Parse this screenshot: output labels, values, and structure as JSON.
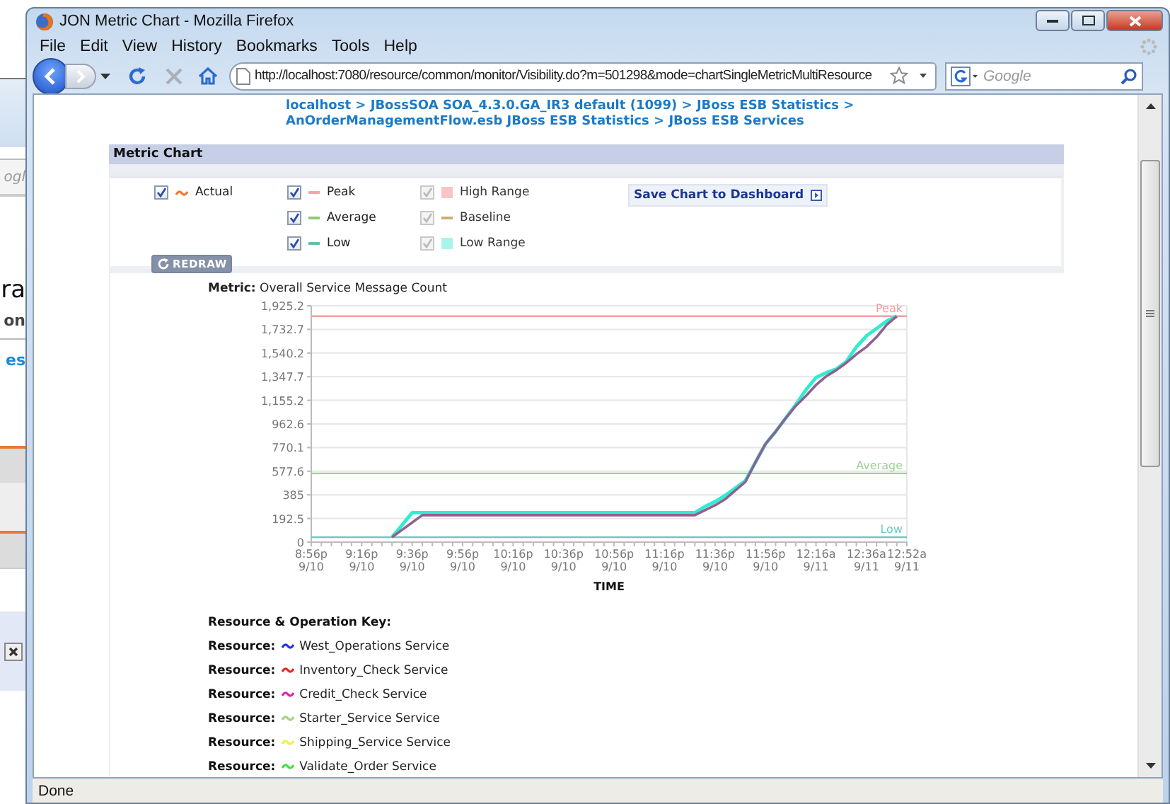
{
  "background_window": {
    "texts": [
      {
        "kind": "field",
        "text": "ogl"
      },
      {
        "kind": "heading",
        "text": "ra"
      },
      {
        "kind": "subheading",
        "text": "on"
      },
      {
        "kind": "link",
        "text": "es"
      }
    ]
  },
  "window": {
    "title": "JON Metric Chart - Mozilla Firefox"
  },
  "menu": [
    "File",
    "Edit",
    "View",
    "History",
    "Bookmarks",
    "Tools",
    "Help"
  ],
  "address_bar": {
    "value": "http://localhost:7080/resource/common/monitor/Visibility.do?m=501298&mode=chartSingleMetricMultiResource"
  },
  "search": {
    "placeholder": "Google"
  },
  "breadcrumb": [
    {
      "kind": "link",
      "text": "localhost"
    },
    {
      "kind": "separator",
      "text": ">"
    },
    {
      "kind": "link",
      "text": "JBossSOA SOA_4.3.0.GA_IR3 default (1099)"
    },
    {
      "kind": "separator",
      "text": ">"
    },
    {
      "kind": "link",
      "text": "JBoss ESB Statistics"
    },
    {
      "kind": "separator",
      "text": ">"
    },
    {
      "kind": "link",
      "text": "AnOrderManagementFlow.esb JBoss ESB Statistics"
    },
    {
      "kind": "separator",
      "text": ">"
    },
    {
      "kind": "link",
      "text": "JBoss ESB Services"
    }
  ],
  "panel": {
    "title": "Metric Chart",
    "options": {
      "columns": [
        [
          {
            "label": "Actual",
            "kind": "wave",
            "color": "#f07830",
            "checked": true,
            "disabled": false
          }
        ],
        [
          {
            "label": "Peak",
            "kind": "line",
            "color": "#f0a8a8",
            "checked": true,
            "disabled": false
          },
          {
            "label": "Average",
            "kind": "line",
            "color": "#90c878",
            "checked": true,
            "disabled": false
          },
          {
            "label": "Low",
            "kind": "line",
            "color": "#60c0b0",
            "checked": true,
            "disabled": false
          }
        ],
        [
          {
            "label": "High Range",
            "kind": "square",
            "color": "#f8c4c4",
            "checked": true,
            "disabled": true
          },
          {
            "label": "Baseline",
            "kind": "line",
            "color": "#c8b070",
            "checked": true,
            "disabled": true
          },
          {
            "label": "Low Range",
            "kind": "square",
            "color": "#a8f4ec",
            "checked": true,
            "disabled": true
          }
        ]
      ]
    },
    "redraw_button": "REDRAW",
    "save_button": "Save Chart to Dashboard",
    "chart_data": {
      "type": "line",
      "title": "**Metric:** Overall Service Message Count",
      "xlabel": "TIME",
      "categories": [
        "8:56p 9/10",
        null,
        null,
        null,
        null,
        "9:16p 9/10",
        null,
        null,
        null,
        null,
        "9:36p 9/10",
        null,
        null,
        null,
        null,
        "9:56p 9/10",
        null,
        null,
        null,
        null,
        "10:16p 9/10",
        null,
        null,
        null,
        null,
        "10:36p 9/10",
        null,
        null,
        null,
        null,
        "10:56p 9/10",
        null,
        null,
        null,
        null,
        "11:16p 9/10",
        null,
        null,
        null,
        null,
        "11:36p 9/10",
        null,
        null,
        null,
        null,
        "11:56p 9/10",
        null,
        null,
        null,
        null,
        "12:16a 9/11",
        null,
        null,
        null,
        null,
        "12:36a 9/11",
        null,
        null,
        null,
        "12:52a 9/11"
      ],
      "series": [
        {
          "color": "#30ecd0",
          "values": [
            null,
            null,
            null,
            null,
            null,
            null,
            null,
            null,
            40,
            140,
            240,
            240,
            240,
            240,
            240,
            240,
            240,
            240,
            240,
            240,
            240,
            240,
            240,
            240,
            240,
            240,
            240,
            240,
            240,
            240,
            240,
            240,
            240,
            240,
            240,
            240,
            240,
            240,
            240,
            290,
            330,
            380,
            440,
            500,
            650,
            800,
            900,
            1010,
            1120,
            1240,
            1340,
            1380,
            1410,
            1470,
            1590,
            1680,
            1740,
            1800,
            1840,
            null
          ]
        },
        {
          "color": "#906090",
          "values": [
            null,
            null,
            null,
            null,
            null,
            null,
            null,
            null,
            40,
            100,
            160,
            220,
            220,
            220,
            220,
            220,
            220,
            220,
            220,
            220,
            220,
            220,
            220,
            220,
            220,
            220,
            220,
            220,
            220,
            220,
            220,
            220,
            220,
            220,
            220,
            220,
            220,
            220,
            220,
            260,
            300,
            350,
            420,
            490,
            650,
            800,
            900,
            1010,
            1110,
            1190,
            1280,
            1350,
            1400,
            1460,
            1530,
            1590,
            1670,
            1770,
            1840,
            null
          ]
        }
      ],
      "ylim": [
        0,
        1925.2
      ],
      "yticks": [
        {
          "value": 0,
          "label": "0"
        },
        {
          "value": 192.5,
          "label": "192.5"
        },
        {
          "value": 385,
          "label": "385"
        },
        {
          "value": 577.6,
          "label": "577.6"
        },
        {
          "value": 770.1,
          "label": "770.1"
        },
        {
          "value": 962.6,
          "label": "962.6"
        },
        {
          "value": 1155.2,
          "label": "1,155.2"
        },
        {
          "value": 1347.7,
          "label": "1,347.7"
        },
        {
          "value": 1540.2,
          "label": "1,540.2"
        },
        {
          "value": 1732.7,
          "label": "1,732.7"
        },
        {
          "value": 1925.2,
          "label": "1,925.2"
        }
      ],
      "grid": true,
      "ref_lines": [
        {
          "axis": "y",
          "value": 1840,
          "label": "Peak",
          "color": "#f0a0a0"
        },
        {
          "axis": "y",
          "value": 560,
          "label": "Average",
          "color": "#a0d090"
        },
        {
          "axis": "y",
          "value": 40,
          "label": "Low",
          "color": "#70c8c0"
        }
      ]
    },
    "resource_key": {
      "title": "Resource & Operation Key:",
      "rows": [
        {
          "label": "Resource:",
          "name": "West_Operations Service",
          "color": "#2030f0"
        },
        {
          "label": "Resource:",
          "name": "Inventory_Check Service",
          "color": "#f02020"
        },
        {
          "label": "Resource:",
          "name": "Credit_Check Service",
          "color": "#e020b0"
        },
        {
          "label": "Resource:",
          "name": "Starter_Service Service",
          "color": "#a8d080"
        },
        {
          "label": "Resource:",
          "name": "Shipping_Service Service",
          "color": "#f0f040"
        },
        {
          "label": "Resource:",
          "name": "Validate_Order Service",
          "color": "#40e040"
        }
      ]
    }
  },
  "status_bar": "Done"
}
